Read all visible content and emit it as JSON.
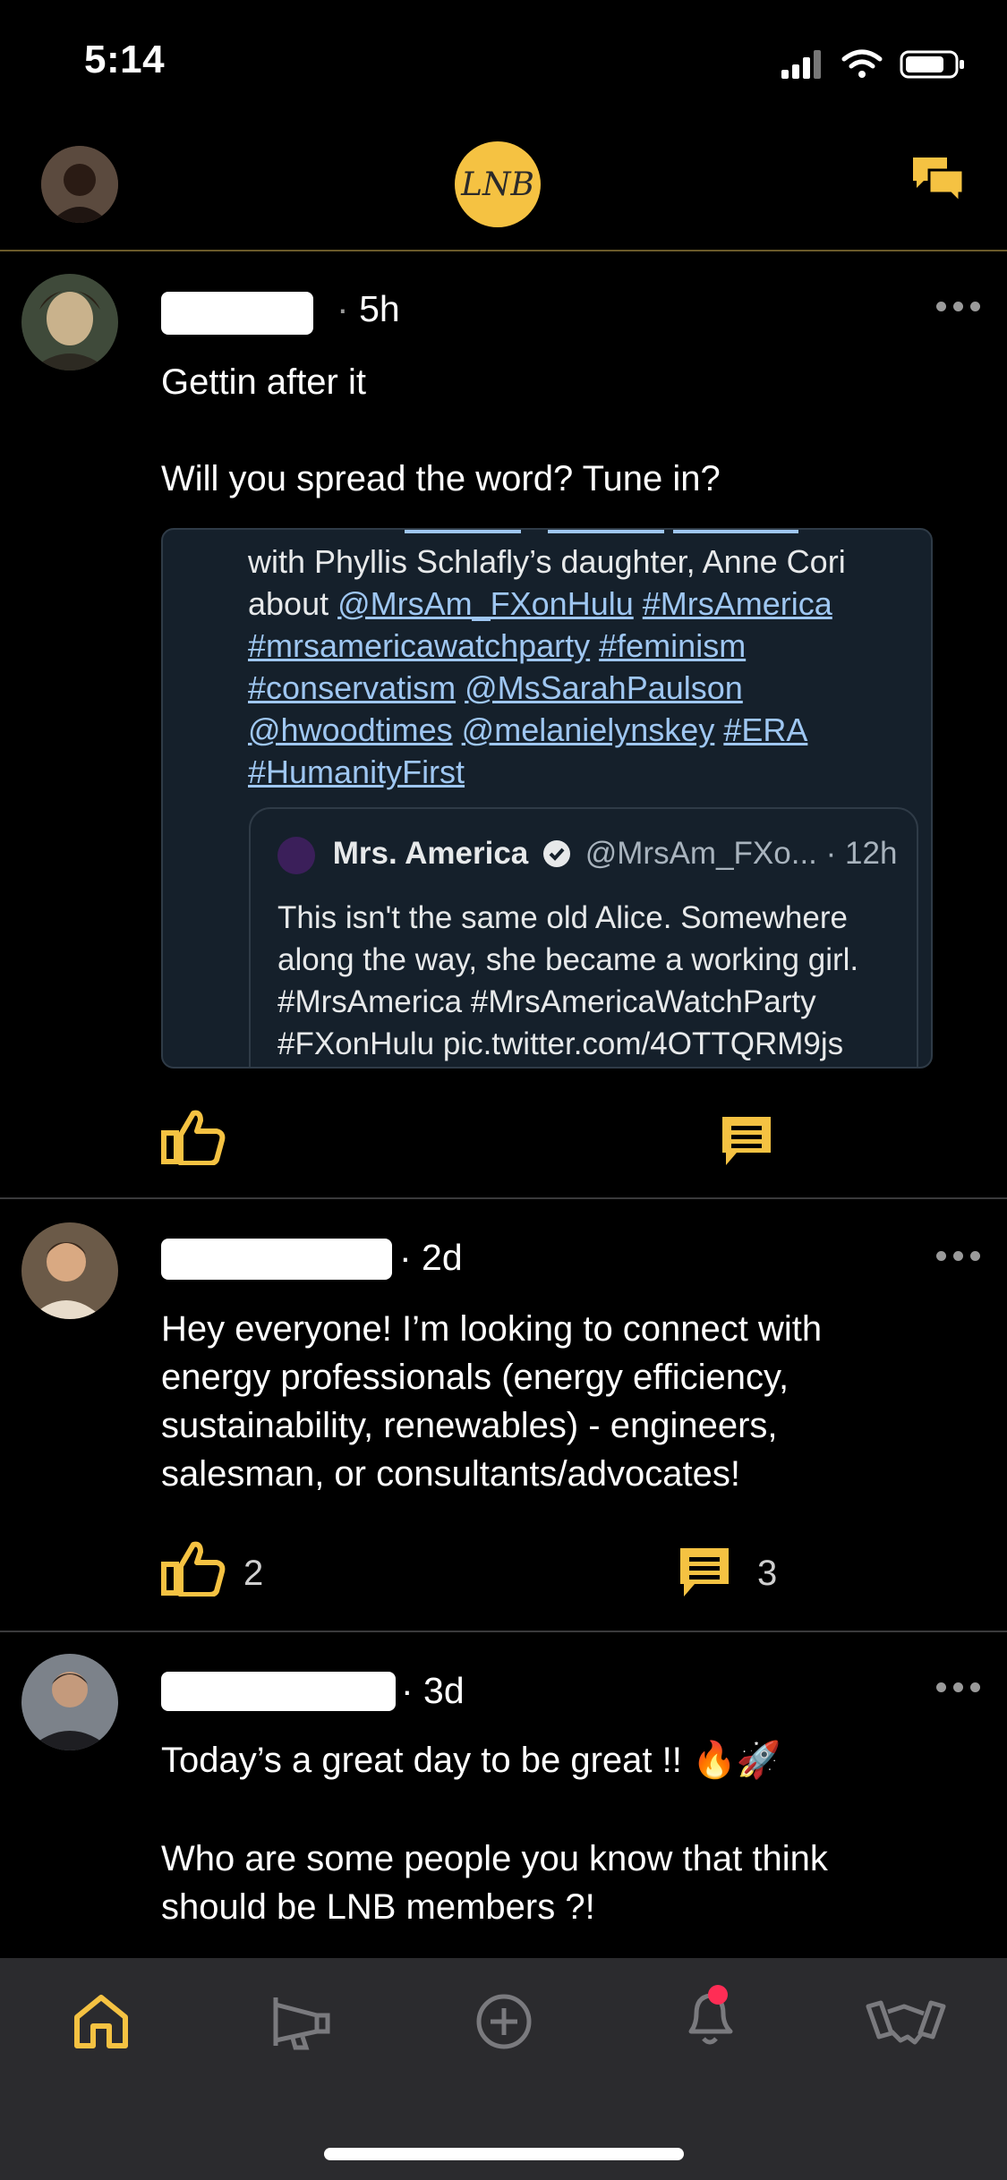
{
  "status_bar": {
    "time": "5:14"
  },
  "header": {
    "logo_text": "LNB"
  },
  "posts": [
    {
      "time": "5h",
      "text_line1": "Gettin after it",
      "text_line2": "Will you spread the word? Tune in?",
      "embed": {
        "line1": "with Phyllis Schlafly’s daughter, Anne Cori",
        "about": "about",
        "link1": "@MrsAm_FXonHulu",
        "link2": "#MrsAmerica",
        "link3": "#mrsamericawatchparty",
        "link4": "#feminism",
        "link5": "#conservatism",
        "link6": "@MsSarahPaulson",
        "link7": "@hwoodtimes",
        "link8": "@melanielynskey",
        "link9": "#ERA",
        "link10": "#HumanityFirst",
        "quote": {
          "name": "Mrs. America",
          "handle": "@MrsAm_FXo...",
          "time": "· 12h",
          "line1": "This isn't the same old Alice. Somewhere",
          "line2": "along the way, she became a working girl.",
          "line3": "#MrsAmerica #MrsAmericaWatchParty",
          "line4": "#FXonHulu pic.twitter.com/4OTTQRM9js"
        }
      }
    },
    {
      "time": "· 2d",
      "text": "Hey everyone! I’m looking to connect with energy professionals (energy efficiency, sustainability, renewables) - engineers, salesman, or consultants/advocates!",
      "likes": "2",
      "comments": "3"
    },
    {
      "time": "· 3d",
      "text_line1": "Today’s a great day to be great !! 🔥🚀",
      "text_line2": "Who are some people you know that think should be LNB members ?!"
    }
  ],
  "colors": {
    "accent": "#f5c242",
    "background": "#000000",
    "tabbar": "#2b2b2e"
  },
  "tabbar": {
    "items": [
      "home-icon",
      "megaphone-icon",
      "add-circle-icon",
      "bell-icon",
      "handshake-icon"
    ]
  }
}
